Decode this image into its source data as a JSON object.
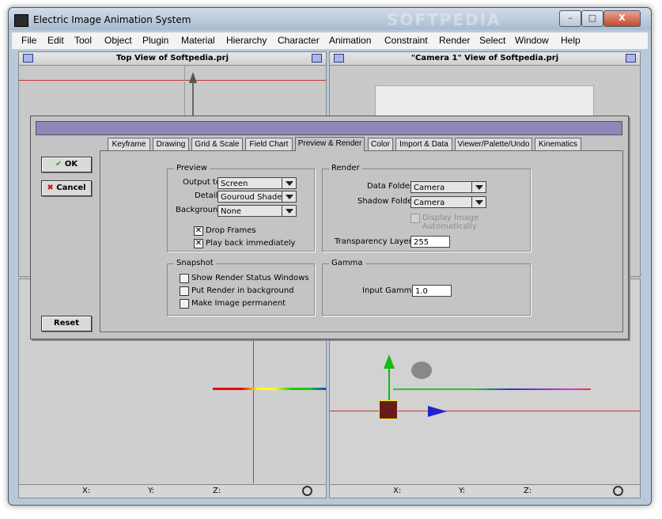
{
  "window": {
    "title": "Electric Image Animation System",
    "watermark": "SOFTPEDIA",
    "buttons": [
      "–",
      "□",
      "X"
    ]
  },
  "menu": [
    "File",
    "Edit",
    "Tool",
    "Object",
    "Plugin",
    "Material",
    "Hierarchy",
    "Character",
    "Animation",
    "Constraint",
    "Render",
    "Select",
    "Window",
    "Help"
  ],
  "viewports": {
    "top_title": "Top View of Softpedia.prj",
    "camera_title": "\"Camera 1\" View of Softpedia.prj"
  },
  "statusbar": {
    "x": "X:",
    "y": "Y:",
    "z": "Z:"
  },
  "dialog": {
    "ok": "OK",
    "cancel": "Cancel",
    "reset": "Reset",
    "tabs": [
      "Keyframe",
      "Drawing",
      "Grid & Scale",
      "Field Chart",
      "Preview & Render",
      "Color",
      "Import & Data",
      "Viewer/Palette/Undo",
      "Kinematics"
    ],
    "active_tab": "Preview & Render",
    "preview": {
      "label": "Preview",
      "output_label": "Output to:",
      "output_value": "Screen",
      "detail_label": "Detail:",
      "detail_value": "Gouroud Shaded",
      "background_label": "Background",
      "background_value": "None",
      "drop_frames": "Drop Frames",
      "play_back": "Play back immediately"
    },
    "render": {
      "label": "Render",
      "data_folder_label": "Data Folder:",
      "data_folder_value": "Camera",
      "shadow_folder_label": "Shadow Folder:",
      "shadow_folder_value": "Camera",
      "display_auto": "Display Image Automatically",
      "transparency_label": "Transparency Layers:",
      "transparency_value": "255"
    },
    "snapshot": {
      "label": "Snapshot",
      "show_status": "Show Render Status Windows",
      "put_render": "Put Render in background",
      "make_permanent": "Make Image permanent"
    },
    "gamma": {
      "label": "Gamma",
      "input_label": "Input Gamma:",
      "input_value": "1.0"
    }
  },
  "colors": {
    "accent": "#8e87b8",
    "dialog": "#c4c4c4",
    "frame": "#b9c9db"
  },
  "icons": [
    "app-icon",
    "ok-check-icon",
    "cancel-x-icon",
    "viewport-menu-icon",
    "magnify-icon",
    "camera-icon"
  ]
}
